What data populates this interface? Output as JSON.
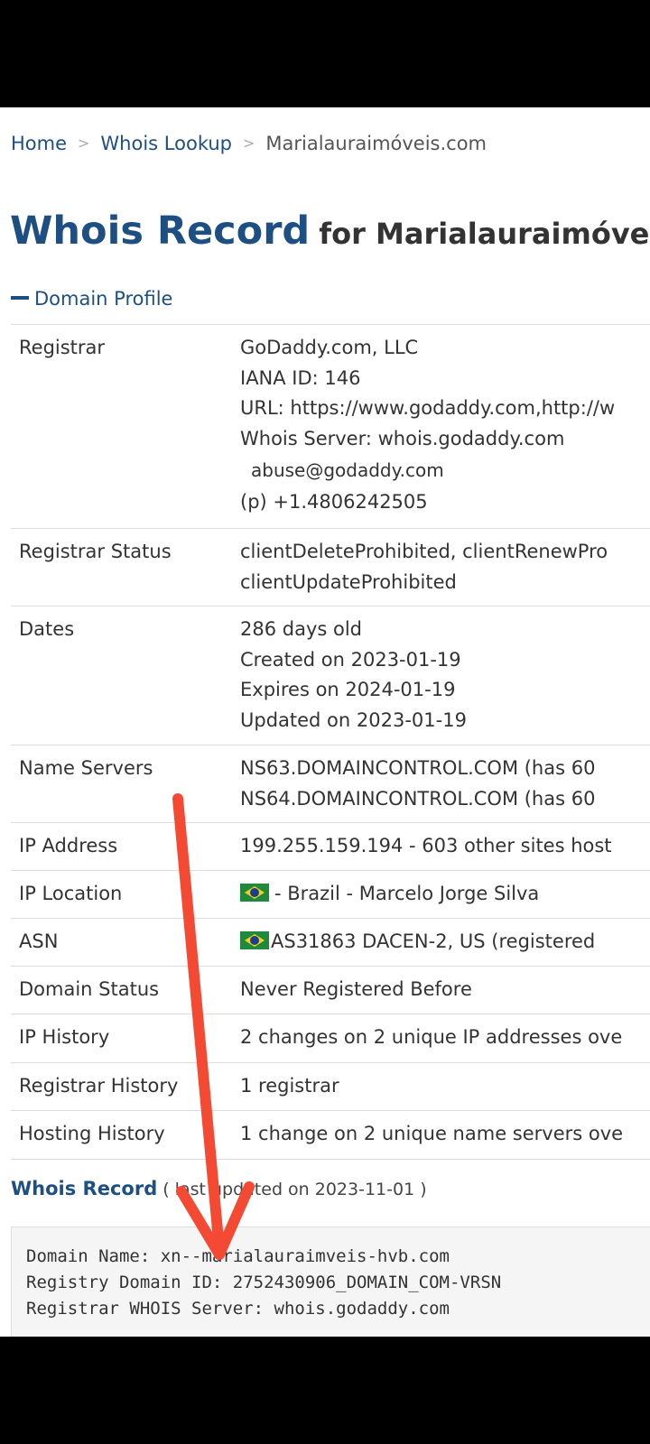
{
  "breadcrumb": {
    "home": "Home",
    "whois_lookup": "Whois Lookup",
    "current": "Marialauraimóveis.com",
    "separator": ">"
  },
  "title": {
    "main": "Whois Record",
    "sub": "for Marialauraimóveis.c"
  },
  "section": {
    "domain_profile": "Domain Profile"
  },
  "profile": {
    "registrar": {
      "label": "Registrar",
      "name": "GoDaddy.com, LLC",
      "iana": "IANA ID: 146",
      "url": "URL: https://www.godaddy.com,http://w",
      "server": "Whois Server: whois.godaddy.com",
      "email": "abuse@godaddy.com",
      "phone": "(p)  +1.4806242505"
    },
    "registrar_status": {
      "label": "Registrar Status",
      "line1": "clientDeleteProhibited, clientRenewPro",
      "line2": "clientUpdateProhibited"
    },
    "dates": {
      "label": "Dates",
      "age": "286 days old",
      "created": "Created on 2023-01-19",
      "expires": "Expires on 2024-01-19",
      "updated": "Updated on 2023-01-19"
    },
    "name_servers": {
      "label": "Name Servers",
      "ns1": "NS63.DOMAINCONTROL.COM (has 60",
      "ns2": "NS64.DOMAINCONTROL.COM (has 60"
    },
    "ip_address": {
      "label": "IP Address",
      "value": "199.255.159.194 - 603 other sites host"
    },
    "ip_location": {
      "label": "IP Location",
      "value": "- Brazil - Marcelo Jorge Silva"
    },
    "asn": {
      "label": "ASN",
      "value": "AS31863 DACEN-2, US (registered"
    },
    "domain_status": {
      "label": "Domain Status",
      "value": "Never Registered Before"
    },
    "ip_history": {
      "label": "IP History",
      "value": "2 changes on 2 unique IP addresses ove"
    },
    "registrar_history": {
      "label": "Registrar History",
      "value": "1 registrar"
    },
    "hosting_history": {
      "label": "Hosting History",
      "value": "1 change on 2 unique name servers ove"
    }
  },
  "whois_record": {
    "heading": "Whois Record",
    "note": "( last updated on 2023-11-01 )",
    "raw_lines": [
      "Domain Name: xn--marialauraimveis-hvb.com",
      "Registry Domain ID: 2752430906_DOMAIN_COM-VRSN",
      "Registrar WHOIS Server: whois.godaddy.com"
    ]
  },
  "colors": {
    "link": "#1e4f82",
    "arrow": "#f44a33",
    "flag_green": "#1f8a3c",
    "flag_yellow": "#f4d21b"
  }
}
